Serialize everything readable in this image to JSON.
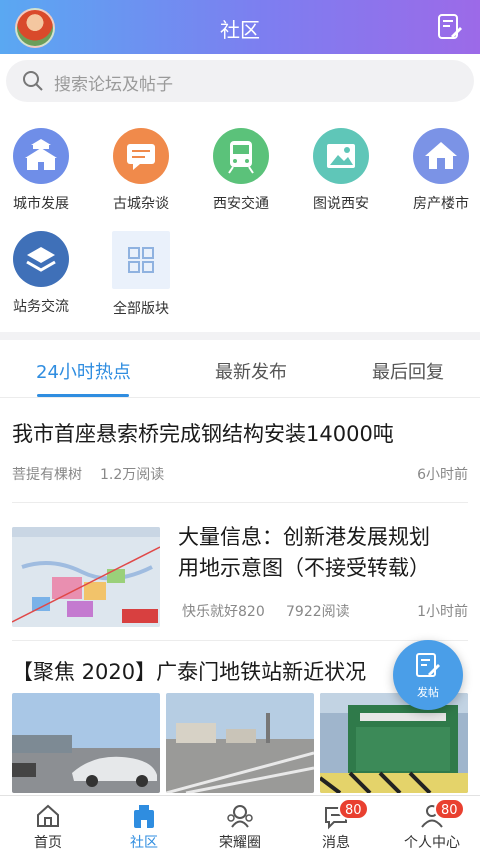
{
  "header": {
    "title": "社区"
  },
  "search": {
    "placeholder": "搜索论坛及帖子"
  },
  "categories": [
    {
      "label": "城市发展",
      "icon": "city-gate-icon",
      "color": "#6f8ee8"
    },
    {
      "label": "古城杂谈",
      "icon": "chat-bubble-icon",
      "color": "#f08a4b"
    },
    {
      "label": "西安交通",
      "icon": "train-icon",
      "color": "#5bc27a"
    },
    {
      "label": "图说西安",
      "icon": "picture-icon",
      "color": "#5fc6b8"
    },
    {
      "label": "房产楼市",
      "icon": "house-icon",
      "color": "#7b93e6"
    },
    {
      "label": "站务交流",
      "icon": "layers-icon",
      "color": "#3f70b8"
    },
    {
      "label": "全部版块",
      "icon": "grid-icon",
      "color": "#eaf1fb"
    }
  ],
  "tabs": [
    {
      "label": "24小时热点",
      "active": true
    },
    {
      "label": "最新发布",
      "active": false
    },
    {
      "label": "最后回复",
      "active": false
    }
  ],
  "posts": [
    {
      "title": "我市首座悬索桥完成钢结构安装14000吨",
      "author": "菩提有棵树",
      "reads": "1.2万阅读",
      "time": "6小时前"
    },
    {
      "title_line1": "大量信息：创新港发展规划",
      "title_line2": "用地示意图（不接受转载）",
      "author": "快乐就好820",
      "reads": "7922阅读",
      "time": "1小时前"
    },
    {
      "title": "【聚焦 2020】广泰门地铁站新近状况"
    }
  ],
  "fab": {
    "label": "发帖"
  },
  "bottom_nav": [
    {
      "label": "首页",
      "icon": "home-icon",
      "active": false
    },
    {
      "label": "社区",
      "icon": "community-icon",
      "active": true
    },
    {
      "label": "荣耀圈",
      "icon": "honor-icon",
      "active": false
    },
    {
      "label": "消息",
      "icon": "message-icon",
      "active": false,
      "badge": "80"
    },
    {
      "label": "个人中心",
      "icon": "profile-icon",
      "active": false,
      "badge": "80"
    }
  ],
  "colors": {
    "accent": "#2f8de0",
    "badge": "#e94030",
    "header_start": "#5aa8f2",
    "header_end": "#9c6ae8"
  }
}
